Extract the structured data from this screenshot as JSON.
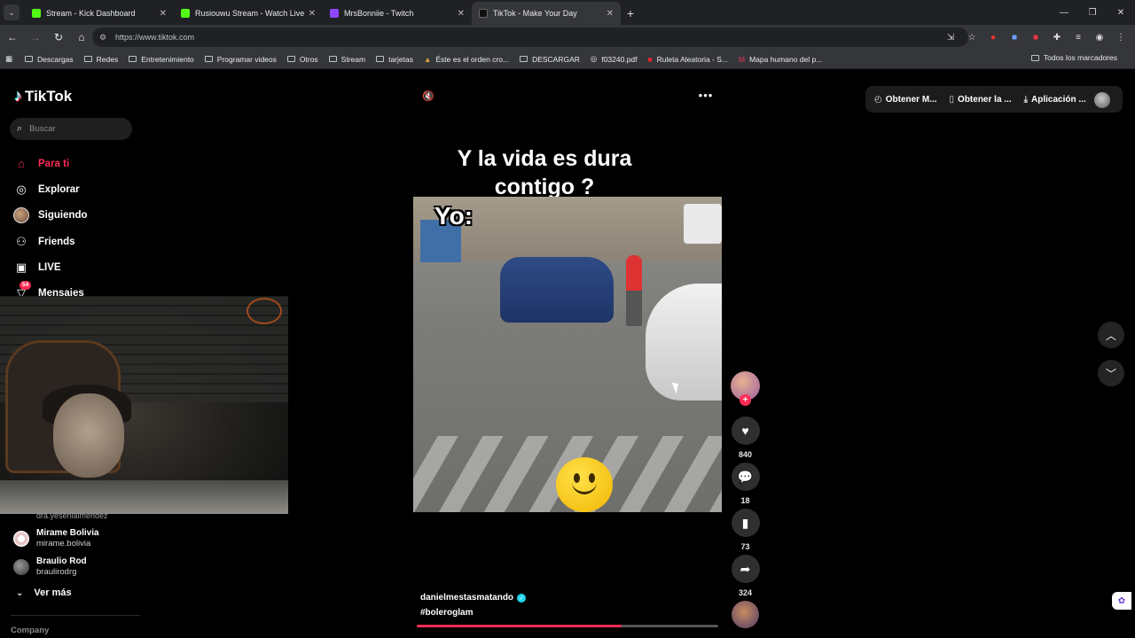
{
  "browser": {
    "tabs": [
      {
        "title": "Stream - Kick Dashboard",
        "favicon_color": "#53fc18",
        "active": false
      },
      {
        "title": "Rusiouwu Stream - Watch Live",
        "favicon_color": "#53fc18",
        "active": false
      },
      {
        "title": "MrsBonniie - Twitch",
        "favicon_color": "#9146ff",
        "active": false
      },
      {
        "title": "TikTok - Make Your Day",
        "favicon_color": "#000000",
        "active": true
      }
    ],
    "url": "https://www.tiktok.com",
    "bookmarks": [
      "Descargas",
      "Redes",
      "Entretenimiento",
      "Programar videos",
      "Otros",
      "Stream",
      "tarjetas",
      "Éste es el orden cro...",
      "DESCARGAR",
      "f03240.pdf",
      "Ruleta Aleatoria - S...",
      "Mapa humano del p..."
    ],
    "all_bookmarks": "Todos los marcadores"
  },
  "tiktok": {
    "logo": "TikTok",
    "search_placeholder": "Buscar",
    "nav": [
      {
        "label": "Para ti",
        "icon": "home-icon",
        "active": true
      },
      {
        "label": "Explorar",
        "icon": "compass-icon",
        "active": false
      },
      {
        "label": "Siguiendo",
        "icon": "following-avatar",
        "active": false
      },
      {
        "label": "Friends",
        "icon": "friends-icon",
        "active": false
      },
      {
        "label": "LIVE",
        "icon": "live-icon",
        "active": false
      },
      {
        "label": "Mensajes",
        "icon": "messages-icon",
        "active": false,
        "badge": "54"
      }
    ],
    "following_cut": "dra.yesenialmendez",
    "following": [
      {
        "name": "Mirame Bolivia",
        "username": "mirame.bolivia"
      },
      {
        "name": "Braulio Rod",
        "username": "braulirodrg"
      }
    ],
    "see_more": "Ver más",
    "company": "Company",
    "top_actions": [
      "Obtener M...",
      "Obtener la ...",
      "Aplicación ..."
    ]
  },
  "video": {
    "caption_line1": "Y la vida es dura",
    "caption_line2": "contigo ?",
    "overlay_text": "Yo:",
    "author": "danielmestasmatando",
    "hashtag": "#boleroglam",
    "progress": 0.68,
    "likes": "840",
    "comments": "18",
    "saves": "73",
    "shares": "324"
  },
  "colors": {
    "accent": "#fe2c55",
    "verified": "#20d5ec",
    "background": "#000000"
  }
}
